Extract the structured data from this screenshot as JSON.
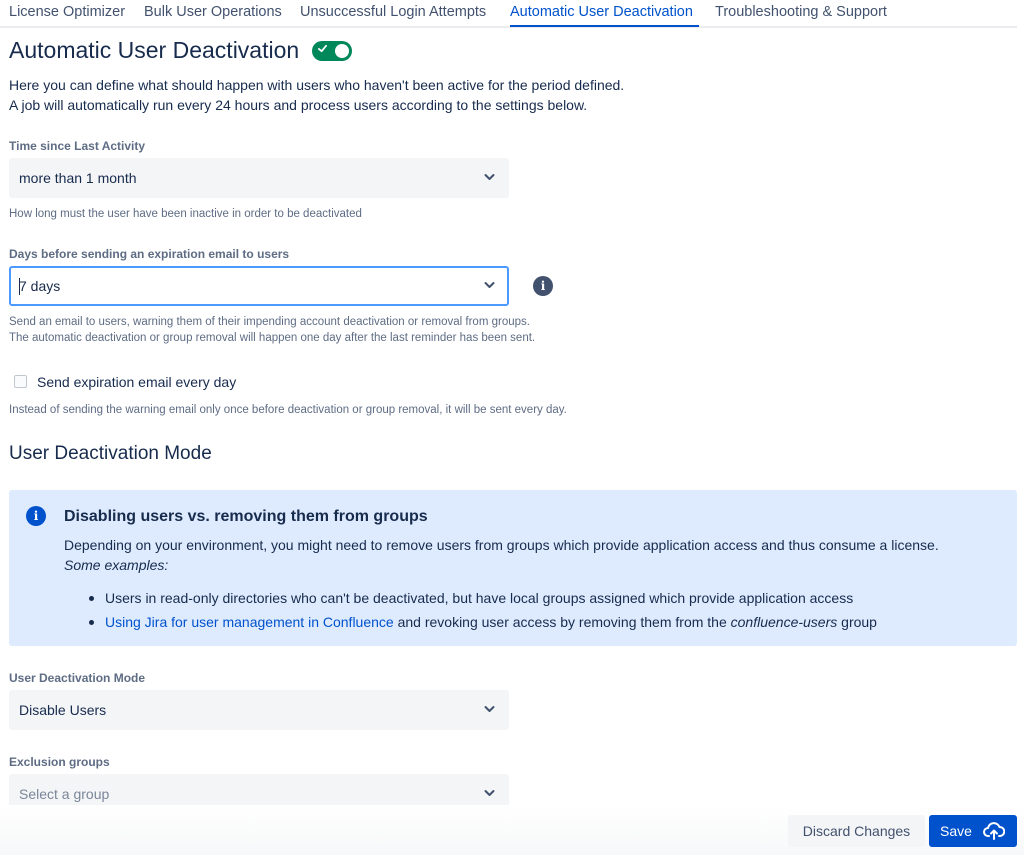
{
  "tabs": [
    {
      "label": "License Optimizer"
    },
    {
      "label": "Bulk User Operations"
    },
    {
      "label": "Unsuccessful Login Attempts"
    },
    {
      "label": "Automatic User Deactivation",
      "active": true
    },
    {
      "label": "Troubleshooting & Support"
    }
  ],
  "page": {
    "title": "Automatic User Deactivation",
    "enabled": true,
    "intro_line1": "Here you can define what should happen with users who haven't been active for the period defined.",
    "intro_line2": "A job will automatically run every 24 hours and process users according to the settings below."
  },
  "time_since_last_activity": {
    "label": "Time since Last Activity",
    "value": "more than 1 month",
    "help": "How long must the user have been inactive in order to be deactivated"
  },
  "expiration_email_days": {
    "label": "Days before sending an expiration email to users",
    "value": "7 days",
    "help_line1": "Send an email to users, warning them of their impending account deactivation or removal from groups.",
    "help_line2": "The automatic deactivation or group removal will happen one day after the last reminder has been sent."
  },
  "send_every_day": {
    "label": "Send expiration email every day",
    "checked": false,
    "help": "Instead of sending the warning email only once before deactivation or group removal, it will be sent every day."
  },
  "mode_section": {
    "title": "User Deactivation Mode"
  },
  "info_panel": {
    "title": "Disabling users vs. removing them from groups",
    "text": "Depending on your environment, you might need to remove users from groups which provide application access and thus consume a license.",
    "examples_label": "Some examples:",
    "bullet1": "Users in read-only directories who can't be deactivated, but have local groups assigned which provide application access",
    "bullet2_link": "Using Jira for user management in Confluence",
    "bullet2_middle": " and revoking user access by removing them from the ",
    "bullet2_group": "confluence-users",
    "bullet2_end": " group"
  },
  "deactivation_mode": {
    "label": "User Deactivation Mode",
    "value": "Disable Users"
  },
  "exclusion_groups": {
    "label": "Exclusion groups",
    "placeholder": "Select a group"
  },
  "actions": {
    "discard_label": "Discard Changes",
    "save_label": "Save"
  },
  "colors": {
    "accent": "#0052cc",
    "toggle_on": "#00875a",
    "info_panel_bg": "#deebff"
  }
}
